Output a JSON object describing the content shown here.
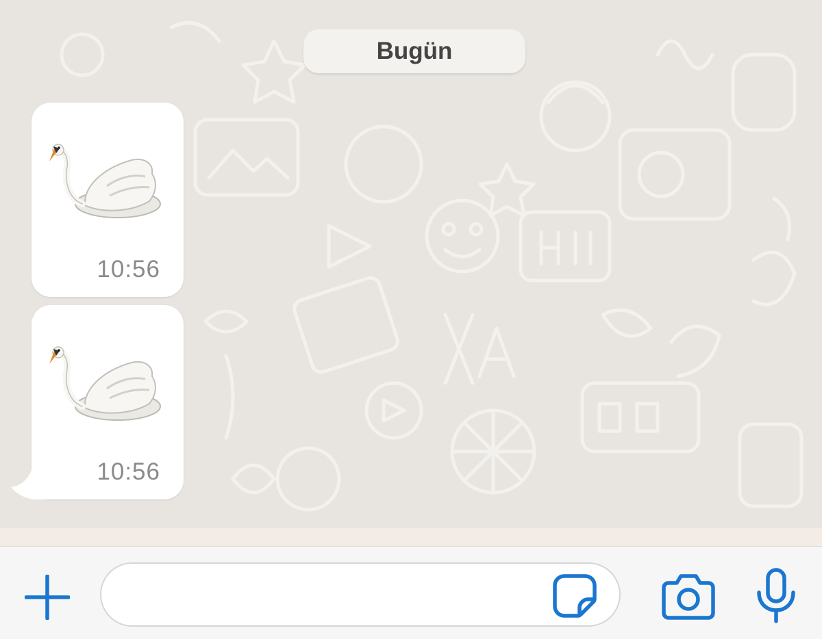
{
  "chat": {
    "date_separator": "Bugün",
    "messages": [
      {
        "content": "swan-emoji",
        "time": "10:56"
      },
      {
        "content": "swan-emoji",
        "time": "10:56"
      }
    ]
  },
  "input_bar": {
    "message_value": "",
    "icons": [
      "plus-icon",
      "sticker-icon",
      "camera-icon",
      "microphone-icon"
    ]
  },
  "colors": {
    "accent": "#1a77d0",
    "chat_background": "#e8e5e0",
    "bubble": "#ffffff",
    "time_text": "#8a8a8a"
  }
}
